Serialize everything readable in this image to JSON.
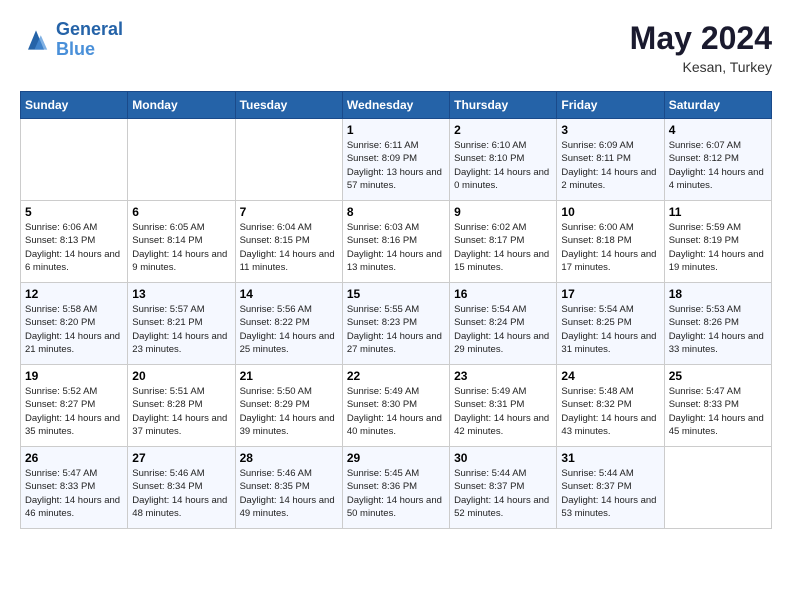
{
  "logo": {
    "line1": "General",
    "line2": "Blue"
  },
  "title": "May 2024",
  "location": "Kesan, Turkey",
  "days_header": [
    "Sunday",
    "Monday",
    "Tuesday",
    "Wednesday",
    "Thursday",
    "Friday",
    "Saturday"
  ],
  "weeks": [
    [
      {
        "num": "",
        "sunrise": "",
        "sunset": "",
        "daylight": ""
      },
      {
        "num": "",
        "sunrise": "",
        "sunset": "",
        "daylight": ""
      },
      {
        "num": "",
        "sunrise": "",
        "sunset": "",
        "daylight": ""
      },
      {
        "num": "1",
        "sunrise": "Sunrise: 6:11 AM",
        "sunset": "Sunset: 8:09 PM",
        "daylight": "Daylight: 13 hours and 57 minutes."
      },
      {
        "num": "2",
        "sunrise": "Sunrise: 6:10 AM",
        "sunset": "Sunset: 8:10 PM",
        "daylight": "Daylight: 14 hours and 0 minutes."
      },
      {
        "num": "3",
        "sunrise": "Sunrise: 6:09 AM",
        "sunset": "Sunset: 8:11 PM",
        "daylight": "Daylight: 14 hours and 2 minutes."
      },
      {
        "num": "4",
        "sunrise": "Sunrise: 6:07 AM",
        "sunset": "Sunset: 8:12 PM",
        "daylight": "Daylight: 14 hours and 4 minutes."
      }
    ],
    [
      {
        "num": "5",
        "sunrise": "Sunrise: 6:06 AM",
        "sunset": "Sunset: 8:13 PM",
        "daylight": "Daylight: 14 hours and 6 minutes."
      },
      {
        "num": "6",
        "sunrise": "Sunrise: 6:05 AM",
        "sunset": "Sunset: 8:14 PM",
        "daylight": "Daylight: 14 hours and 9 minutes."
      },
      {
        "num": "7",
        "sunrise": "Sunrise: 6:04 AM",
        "sunset": "Sunset: 8:15 PM",
        "daylight": "Daylight: 14 hours and 11 minutes."
      },
      {
        "num": "8",
        "sunrise": "Sunrise: 6:03 AM",
        "sunset": "Sunset: 8:16 PM",
        "daylight": "Daylight: 14 hours and 13 minutes."
      },
      {
        "num": "9",
        "sunrise": "Sunrise: 6:02 AM",
        "sunset": "Sunset: 8:17 PM",
        "daylight": "Daylight: 14 hours and 15 minutes."
      },
      {
        "num": "10",
        "sunrise": "Sunrise: 6:00 AM",
        "sunset": "Sunset: 8:18 PM",
        "daylight": "Daylight: 14 hours and 17 minutes."
      },
      {
        "num": "11",
        "sunrise": "Sunrise: 5:59 AM",
        "sunset": "Sunset: 8:19 PM",
        "daylight": "Daylight: 14 hours and 19 minutes."
      }
    ],
    [
      {
        "num": "12",
        "sunrise": "Sunrise: 5:58 AM",
        "sunset": "Sunset: 8:20 PM",
        "daylight": "Daylight: 14 hours and 21 minutes."
      },
      {
        "num": "13",
        "sunrise": "Sunrise: 5:57 AM",
        "sunset": "Sunset: 8:21 PM",
        "daylight": "Daylight: 14 hours and 23 minutes."
      },
      {
        "num": "14",
        "sunrise": "Sunrise: 5:56 AM",
        "sunset": "Sunset: 8:22 PM",
        "daylight": "Daylight: 14 hours and 25 minutes."
      },
      {
        "num": "15",
        "sunrise": "Sunrise: 5:55 AM",
        "sunset": "Sunset: 8:23 PM",
        "daylight": "Daylight: 14 hours and 27 minutes."
      },
      {
        "num": "16",
        "sunrise": "Sunrise: 5:54 AM",
        "sunset": "Sunset: 8:24 PM",
        "daylight": "Daylight: 14 hours and 29 minutes."
      },
      {
        "num": "17",
        "sunrise": "Sunrise: 5:54 AM",
        "sunset": "Sunset: 8:25 PM",
        "daylight": "Daylight: 14 hours and 31 minutes."
      },
      {
        "num": "18",
        "sunrise": "Sunrise: 5:53 AM",
        "sunset": "Sunset: 8:26 PM",
        "daylight": "Daylight: 14 hours and 33 minutes."
      }
    ],
    [
      {
        "num": "19",
        "sunrise": "Sunrise: 5:52 AM",
        "sunset": "Sunset: 8:27 PM",
        "daylight": "Daylight: 14 hours and 35 minutes."
      },
      {
        "num": "20",
        "sunrise": "Sunrise: 5:51 AM",
        "sunset": "Sunset: 8:28 PM",
        "daylight": "Daylight: 14 hours and 37 minutes."
      },
      {
        "num": "21",
        "sunrise": "Sunrise: 5:50 AM",
        "sunset": "Sunset: 8:29 PM",
        "daylight": "Daylight: 14 hours and 39 minutes."
      },
      {
        "num": "22",
        "sunrise": "Sunrise: 5:49 AM",
        "sunset": "Sunset: 8:30 PM",
        "daylight": "Daylight: 14 hours and 40 minutes."
      },
      {
        "num": "23",
        "sunrise": "Sunrise: 5:49 AM",
        "sunset": "Sunset: 8:31 PM",
        "daylight": "Daylight: 14 hours and 42 minutes."
      },
      {
        "num": "24",
        "sunrise": "Sunrise: 5:48 AM",
        "sunset": "Sunset: 8:32 PM",
        "daylight": "Daylight: 14 hours and 43 minutes."
      },
      {
        "num": "25",
        "sunrise": "Sunrise: 5:47 AM",
        "sunset": "Sunset: 8:33 PM",
        "daylight": "Daylight: 14 hours and 45 minutes."
      }
    ],
    [
      {
        "num": "26",
        "sunrise": "Sunrise: 5:47 AM",
        "sunset": "Sunset: 8:33 PM",
        "daylight": "Daylight: 14 hours and 46 minutes."
      },
      {
        "num": "27",
        "sunrise": "Sunrise: 5:46 AM",
        "sunset": "Sunset: 8:34 PM",
        "daylight": "Daylight: 14 hours and 48 minutes."
      },
      {
        "num": "28",
        "sunrise": "Sunrise: 5:46 AM",
        "sunset": "Sunset: 8:35 PM",
        "daylight": "Daylight: 14 hours and 49 minutes."
      },
      {
        "num": "29",
        "sunrise": "Sunrise: 5:45 AM",
        "sunset": "Sunset: 8:36 PM",
        "daylight": "Daylight: 14 hours and 50 minutes."
      },
      {
        "num": "30",
        "sunrise": "Sunrise: 5:44 AM",
        "sunset": "Sunset: 8:37 PM",
        "daylight": "Daylight: 14 hours and 52 minutes."
      },
      {
        "num": "31",
        "sunrise": "Sunrise: 5:44 AM",
        "sunset": "Sunset: 8:37 PM",
        "daylight": "Daylight: 14 hours and 53 minutes."
      },
      {
        "num": "",
        "sunrise": "",
        "sunset": "",
        "daylight": ""
      }
    ]
  ]
}
